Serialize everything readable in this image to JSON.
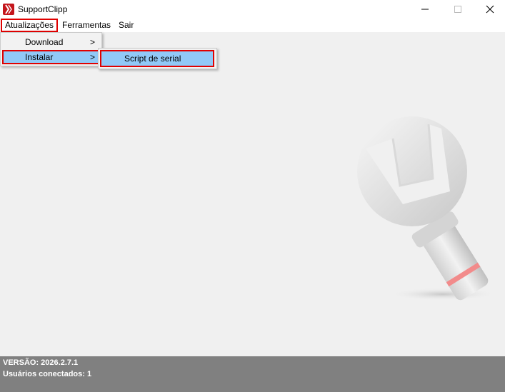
{
  "window": {
    "title": "SupportClipp"
  },
  "menubar": {
    "items": [
      "Atualizações",
      "Ferramentas",
      "Sair"
    ]
  },
  "dropdown": {
    "items": [
      {
        "label": "Download",
        "chevron": ">"
      },
      {
        "label": "Instalar",
        "chevron": ">"
      }
    ]
  },
  "submenu": {
    "items": [
      "Script de serial"
    ]
  },
  "status": {
    "version": "VERSÃO: 2026.2.7.1",
    "users": "Usuários conectados: 1"
  },
  "icons": {
    "app": "app-logo-icon",
    "illustration": "wrench-icon"
  },
  "colors": {
    "highlight": "#91c9f7",
    "annotation": "#e00000",
    "statusbar": "#808080",
    "brand": "#c4161c"
  }
}
